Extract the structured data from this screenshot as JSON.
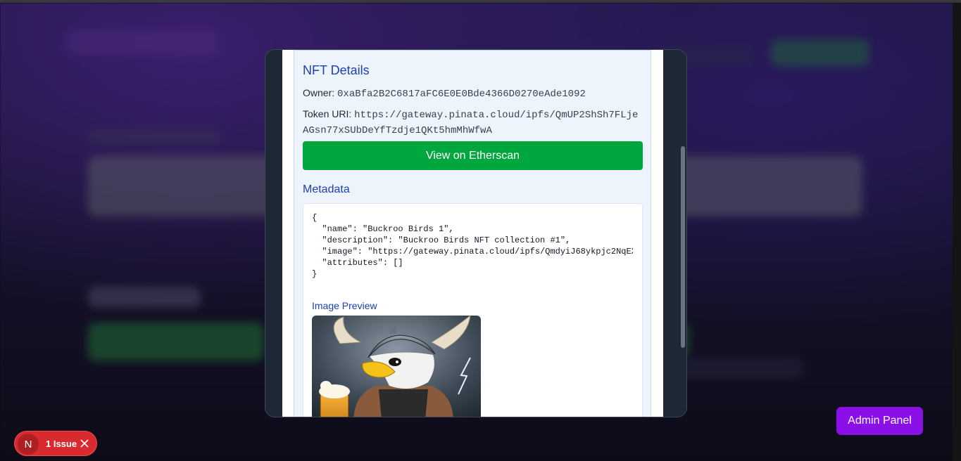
{
  "nft_details": {
    "title": "NFT Details",
    "owner_label": "Owner:",
    "owner_value": "0xaBfa2B2C6817aFC6E0E0Bde4366D0270eAde1092",
    "token_uri_label": "Token URI:",
    "token_uri_value": "https://gateway.pinata.cloud/ipfs/QmUP2ShSh7FLjeAGsn77xSUbDeYfTzdje1QKt5hmMhWfwA",
    "etherscan_button": "View on Etherscan"
  },
  "metadata": {
    "title": "Metadata",
    "json_text": "{\n  \"name\": \"Buckroo Birds 1\",\n  \"description\": \"Buckroo Birds NFT collection #1\",\n  \"image\": \"https://gateway.pinata.cloud/ipfs/QmdyiJ68ykpjc2NqEX\n  \"attributes\": []\n}",
    "image_preview_label": "Image Preview"
  },
  "admin_panel_button": "Admin Panel",
  "dev_indicator": {
    "letter": "N",
    "issues_label": "1 Issue"
  },
  "colors": {
    "etherscan_green": "#00a63e",
    "admin_purple": "#8b10e8",
    "issue_red": "#d92a2f",
    "heading_blue": "#1e40af"
  }
}
